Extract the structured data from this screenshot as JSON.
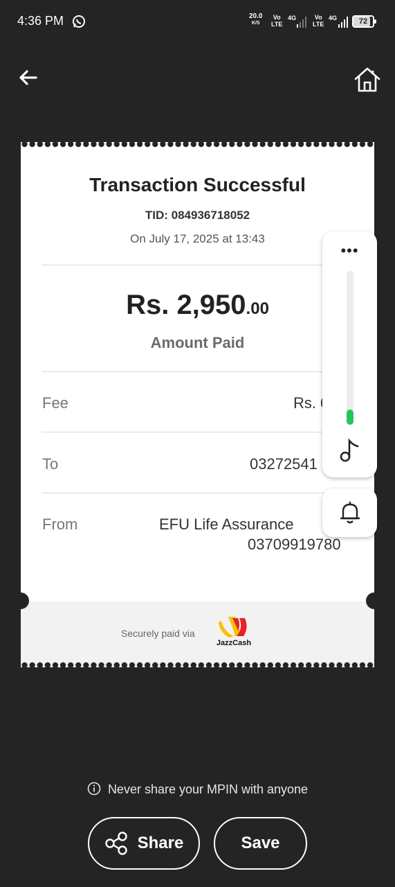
{
  "status_bar": {
    "time": "4:36 PM",
    "net_speed": "20.0",
    "net_speed_unit": "K/S",
    "sim1": "Vo\nLTE",
    "sim1_type": "4G",
    "sim2": "Vo\nLTE",
    "sim2_type": "4G",
    "battery": "72"
  },
  "receipt": {
    "title": "Transaction Successful",
    "tid": "TID: 084936718052",
    "date": "On July 17, 2025 at 13:43",
    "amount_main": "Rs. 2,950",
    "amount_cents": ".00",
    "amount_label": "Amount Paid",
    "rows": [
      {
        "label": "Fee",
        "value": "Rs. 0"
      },
      {
        "label": "To",
        "value": "03272541"
      },
      {
        "label": "From",
        "value": "EFU Life Assurance",
        "value2": "03709919780"
      }
    ],
    "footer_text": "Securely paid via",
    "logo_text": "JazzCash"
  },
  "volume_panel": {
    "dots": "•••",
    "level": 0.1
  },
  "warning": "Never share your MPIN with anyone",
  "buttons": {
    "share": "Share",
    "save": "Save"
  },
  "colors": {
    "background": "#242424",
    "accent_green": "#22c55e",
    "jazz_yellow": "#f5c400",
    "jazz_red": "#e8202a"
  }
}
